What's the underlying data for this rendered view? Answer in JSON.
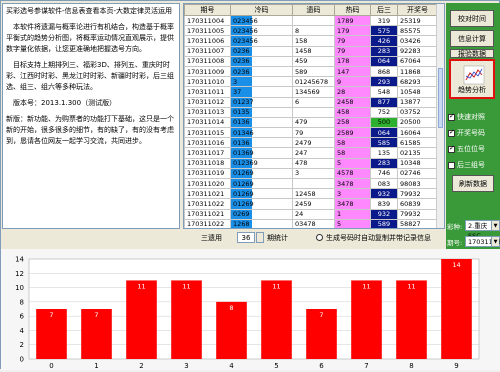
{
  "left_panel": {
    "paragraphs": [
      "买彩选号参谋软件-信息表查看本页-大数定律灵活运用",
      "　本软件将遗漏与概率论进行有机结合，构造基于概率平衡式的趋势分析图，将概率运动情况直观展示，提供数字量化依据，让您更准确地把握选号方向。",
      "　目标支持上期排列三、福彩3D、排列五、重庆时时彩、江西时时彩、黑龙江时时彩、新疆时时彩，后三组选、组三、组六等多种玩法。",
      "　版本号：2013.1.300（测试版）",
      "新版：新功能、为购票者的功能打下基础，这只是一个新的开始，很多很多的细节，有的缺了，有的没有考虑到，恳请各位网友一起学习交流，共同进步。"
    ]
  },
  "grid": {
    "headers": [
      "期号",
      "冷码",
      "遗码",
      "热码",
      "后三",
      "开奖号"
    ],
    "rows": [
      {
        "issue": "170311004",
        "cold": "023456",
        "cold_fill": 0.35,
        "miss": "",
        "hot": "1789",
        "after3": "319",
        "after3_bg": "white",
        "span": "25319"
      },
      {
        "issue": "170311005",
        "cold": "023456",
        "cold_fill": 0.35,
        "miss": "8",
        "hot": "179",
        "after3": "575",
        "after3_bg": "blue",
        "span": "85575"
      },
      {
        "issue": "170311006",
        "cold": "023456",
        "cold_fill": 0.35,
        "miss": "158",
        "hot": "79",
        "after3": "426",
        "after3_bg": "blue",
        "span": "03426"
      },
      {
        "issue": "170311007",
        "cold": "0236",
        "cold_fill": 0.35,
        "miss": "1458",
        "hot": "79",
        "after3": "283",
        "after3_bg": "blue",
        "span": "92283"
      },
      {
        "issue": "170311008",
        "cold": "0236",
        "cold_fill": 0.35,
        "miss": "459",
        "hot": "178",
        "after3": "064",
        "after3_bg": "blue",
        "span": "67064"
      },
      {
        "issue": "170311009",
        "cold": "0236",
        "cold_fill": 0.35,
        "miss": "589",
        "hot": "147",
        "after3": "868",
        "after3_bg": "white",
        "span": "11868"
      },
      {
        "issue": "170311010",
        "cold": "3",
        "cold_fill": 0.35,
        "miss": "01245678",
        "hot": "9",
        "after3": "293",
        "after3_bg": "blue",
        "span": "68293"
      },
      {
        "issue": "170311011",
        "cold": "37",
        "cold_fill": 0.35,
        "miss": "134569",
        "hot": "28",
        "after3": "548",
        "after3_bg": "white",
        "span": "10548"
      },
      {
        "issue": "170311012",
        "cold": "01237",
        "cold_fill": 0.35,
        "miss": "6",
        "hot": "2458",
        "after3": "877",
        "after3_bg": "blue",
        "span": "13877"
      },
      {
        "issue": "170311013",
        "cold": "0135",
        "cold_fill": 0.35,
        "miss": "",
        "hot": "458",
        "after3": "752",
        "after3_bg": "white",
        "span": "03752"
      },
      {
        "issue": "170311014",
        "cold": "0136",
        "cold_fill": 0.35,
        "miss": "479",
        "hot": "258",
        "after3": "500",
        "after3_bg": "green",
        "span": "20500"
      },
      {
        "issue": "170311015",
        "cold": "01346",
        "cold_fill": 0.35,
        "miss": "79",
        "hot": "2589",
        "after3": "064",
        "after3_bg": "blue",
        "span": "16064"
      },
      {
        "issue": "170311016",
        "cold": "0136",
        "cold_fill": 0.35,
        "miss": "2479",
        "hot": "58",
        "after3": "585",
        "after3_bg": "blue",
        "span": "61585"
      },
      {
        "issue": "170311017",
        "cold": "01369",
        "cold_fill": 0.35,
        "miss": "247",
        "hot": "58",
        "after3": "135",
        "after3_bg": "white",
        "span": "02135"
      },
      {
        "issue": "170311018",
        "cold": "012369",
        "cold_fill": 0.35,
        "miss": "478",
        "hot": "5",
        "after3": "283",
        "after3_bg": "blue",
        "span": "10348"
      },
      {
        "issue": "170311019",
        "cold": "01269",
        "cold_fill": 0.35,
        "miss": "3",
        "hot": "4578",
        "after3": "746",
        "after3_bg": "white",
        "span": "02746"
      },
      {
        "issue": "170311020",
        "cold": "01269",
        "cold_fill": 0.35,
        "miss": "",
        "hot": "3478",
        "after3": "083",
        "after3_bg": "white",
        "span": "98083"
      },
      {
        "issue": "170311021",
        "cold": "01269",
        "cold_fill": 0.35,
        "miss": "12458",
        "hot": "3",
        "after3": "932",
        "after3_bg": "blue",
        "span": "79932"
      },
      {
        "issue": "170311022",
        "cold": "01269",
        "cold_fill": 0.35,
        "miss": "2459",
        "hot": "3478",
        "after3": "839",
        "after3_bg": "white",
        "span": "60839"
      },
      {
        "issue": "170311021",
        "cold": "0269",
        "cold_fill": 0.35,
        "miss": "24",
        "hot": "1",
        "after3": "932",
        "after3_bg": "blue",
        "span": "79932"
      },
      {
        "issue": "170311022",
        "cold": "1268",
        "cold_fill": 0.35,
        "miss": "03478",
        "hot": "5",
        "after3": "589",
        "after3_bg": "blue",
        "span": "58827"
      },
      {
        "issue": "170311023",
        "cold": "0245",
        "cold_fill": 0.35,
        "miss": "9",
        "hot": "23589",
        "after3": "216",
        "after3_bg": "white",
        "span": "60216"
      },
      {
        "issue": "170311024",
        "cold": "1368",
        "cold_fill": 0.35,
        "miss": "0578",
        "hot": "239",
        "after3": "",
        "after3_bg": "white",
        "span": ""
      }
    ]
  },
  "right_panel": {
    "btn_check": "校对时间",
    "btn_calc": "信息计算",
    "btn_refresh_info": "报验数据",
    "trend_label": "趋势分析",
    "checks": [
      {
        "label": "快速对照",
        "on": true
      },
      {
        "label": "开奖号码",
        "on": true
      },
      {
        "label": "五位位号",
        "on": true
      },
      {
        "label": "后三组号",
        "on": false
      }
    ],
    "btn_refresh": "刷新数据",
    "lottery_label": "彩种:",
    "lottery_value": "2.重庆SSC",
    "issue_label": "期号:",
    "issue_value": "170311023"
  },
  "bottom_bar": {
    "label_prefix": "三遗用",
    "period_value": "36",
    "label_suffix": "期统计",
    "radio_label": "生成号码时自动复制并带记录信息"
  },
  "chart_data": {
    "type": "bar",
    "categories": [
      "0",
      "1",
      "2",
      "3",
      "4",
      "5",
      "6",
      "7",
      "8",
      "9"
    ],
    "values": [
      7,
      7,
      11,
      11,
      8,
      11,
      7,
      11,
      11,
      14
    ],
    "ylim": [
      0,
      14
    ],
    "yticks": [
      0,
      2,
      4,
      6,
      8,
      10,
      12,
      14
    ],
    "bar_color": "#ff0000",
    "label_color": "#ffffff",
    "grid": true
  }
}
